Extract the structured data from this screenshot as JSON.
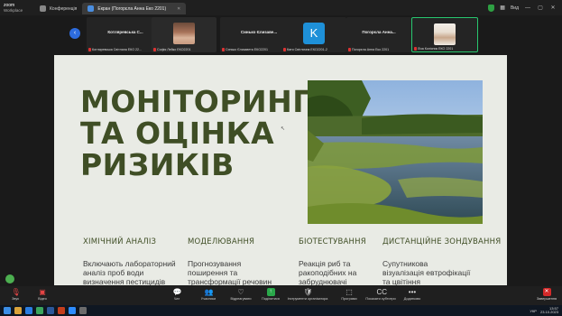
{
  "app": {
    "brand": "zoom",
    "name": "Workplace"
  },
  "tabs": [
    {
      "label": "Конференція",
      "active": false
    },
    {
      "label": "Екран (Погорєла Анна Еко 2201)",
      "active": true
    }
  ],
  "titlebar": {
    "zoom_indicator": "Вид"
  },
  "participants": [
    {
      "name": "Котляревська С...",
      "caption": "Котляревська Світлана ЕКО 22...",
      "kind": "name"
    },
    {
      "name": "",
      "caption": "Софія Лейко ЕКО2201",
      "kind": "photo"
    },
    {
      "name": "Синько Єлизаве...",
      "caption": "Синько Єлизавета ЕКО2201",
      "kind": "name"
    },
    {
      "name": "K",
      "caption": "Катя Світлична ЕКО2201-2",
      "kind": "initial"
    },
    {
      "name": "Погорєла Анна...",
      "caption": "Погорєла Анна Еко 2201",
      "kind": "name"
    },
    {
      "name": "",
      "caption": "Ліза Колісник ЕКО 2201",
      "kind": "photo",
      "speaking": true
    }
  ],
  "slide": {
    "title_lines": [
      "МОНІТОРИНГ",
      "ТА ОЦІНКА",
      "РИЗИКІВ"
    ],
    "columns": [
      {
        "heading": "ХІМІЧНИЙ АНАЛІЗ",
        "text": "Включають лабораторний\nаналіз проб води\nвизначення пестицидів"
      },
      {
        "heading": "МОДЕЛЮВАННЯ",
        "text": "Прогнозування\nпоширення та\nтрансформації речовин"
      },
      {
        "heading": "БІОТЕСТУВАННЯ",
        "text": "Реакція риб та\nракоподібних на\nзабруднювачі"
      },
      {
        "heading": "ДИСТАНЦІЙНЕ ЗОНДУВАННЯ",
        "text": "Супутникова\nвізуалізація евтрофікації\nта цвітіння"
      }
    ]
  },
  "toolbar": {
    "items": [
      {
        "label": "Звук",
        "icon": "mic-muted-icon"
      },
      {
        "label": "Відео",
        "icon": "camera-off-icon"
      },
      {
        "label": "Чат",
        "icon": "chat-icon"
      },
      {
        "label": "Учасники",
        "icon": "participants-icon"
      },
      {
        "label": "Відреагувати",
        "icon": "react-icon"
      },
      {
        "label": "Поділитися",
        "icon": "share-icon"
      },
      {
        "label": "Інструменти організатора",
        "icon": "host-tools-icon"
      },
      {
        "label": "Програми",
        "icon": "apps-icon"
      },
      {
        "label": "Показати субтитри",
        "icon": "captions-icon"
      },
      {
        "label": "Додатково",
        "icon": "more-icon"
      }
    ],
    "end_label": "Завершення"
  },
  "taskbar": {
    "lang": "УКР",
    "time": "13:57",
    "date": "23.10.2023"
  },
  "colors": {
    "slide_bg": "#e9ebe5",
    "title": "#3f4e25",
    "speaking": "#28c76f",
    "end": "#d42a2a"
  }
}
